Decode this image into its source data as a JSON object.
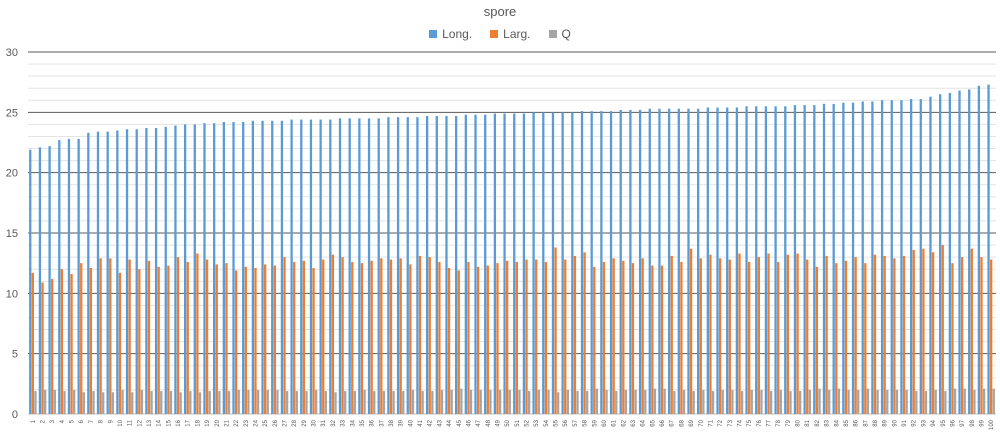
{
  "chart_data": {
    "type": "bar",
    "title": "spore",
    "xlabel": "",
    "ylabel": "",
    "ylim": [
      0,
      30
    ],
    "yticks": [
      0,
      5,
      10,
      15,
      20,
      25,
      30
    ],
    "grid": true,
    "legend_position": "top",
    "categories": [
      "1",
      "2",
      "3",
      "4",
      "5",
      "6",
      "7",
      "8",
      "9",
      "10",
      "11",
      "12",
      "13",
      "14",
      "15",
      "16",
      "17",
      "18",
      "19",
      "20",
      "21",
      "22",
      "23",
      "24",
      "25",
      "26",
      "27",
      "28",
      "29",
      "30",
      "31",
      "32",
      "33",
      "34",
      "35",
      "36",
      "37",
      "38",
      "39",
      "40",
      "41",
      "42",
      "43",
      "44",
      "45",
      "46",
      "47",
      "48",
      "49",
      "50",
      "51",
      "52",
      "53",
      "54",
      "55",
      "56",
      "57",
      "58",
      "59",
      "60",
      "61",
      "62",
      "63",
      "64",
      "65",
      "66",
      "67",
      "68",
      "69",
      "70",
      "71",
      "72",
      "73",
      "74",
      "75",
      "76",
      "77",
      "78",
      "79",
      "80",
      "81",
      "82",
      "83",
      "84",
      "85",
      "86",
      "87",
      "88",
      "89",
      "90",
      "91",
      "92",
      "93",
      "94",
      "95",
      "96",
      "97",
      "98",
      "99",
      "100"
    ],
    "series": [
      {
        "name": "Long.",
        "color": "#5B9BD5",
        "values": [
          21.9,
          22.1,
          22.2,
          22.7,
          22.8,
          22.8,
          23.3,
          23.4,
          23.4,
          23.5,
          23.6,
          23.6,
          23.7,
          23.7,
          23.8,
          23.9,
          24.0,
          24.0,
          24.1,
          24.1,
          24.2,
          24.2,
          24.2,
          24.3,
          24.3,
          24.3,
          24.3,
          24.4,
          24.4,
          24.4,
          24.4,
          24.4,
          24.5,
          24.5,
          24.5,
          24.5,
          24.5,
          24.6,
          24.6,
          24.6,
          24.6,
          24.7,
          24.7,
          24.7,
          24.7,
          24.8,
          24.8,
          24.8,
          24.9,
          24.9,
          24.9,
          24.9,
          25.0,
          25.0,
          25.0,
          25.0,
          25.0,
          25.1,
          25.1,
          25.1,
          25.1,
          25.2,
          25.2,
          25.2,
          25.3,
          25.3,
          25.3,
          25.3,
          25.3,
          25.3,
          25.4,
          25.4,
          25.4,
          25.4,
          25.5,
          25.5,
          25.5,
          25.5,
          25.5,
          25.6,
          25.6,
          25.6,
          25.7,
          25.7,
          25.8,
          25.8,
          25.9,
          25.9,
          26.0,
          26.0,
          26.0,
          26.1,
          26.1,
          26.3,
          26.5,
          26.6,
          26.8,
          26.9,
          27.2,
          27.3
        ]
      },
      {
        "name": "Larg.",
        "color": "#ED7D31",
        "values": [
          11.7,
          10.9,
          11.2,
          12.0,
          11.6,
          12.5,
          12.1,
          12.9,
          12.9,
          11.7,
          12.8,
          12.0,
          12.7,
          12.2,
          12.3,
          13.0,
          12.6,
          13.3,
          12.8,
          12.4,
          12.5,
          11.9,
          12.2,
          12.1,
          12.4,
          12.3,
          13.0,
          12.6,
          12.7,
          12.1,
          12.8,
          13.2,
          13.0,
          12.6,
          12.5,
          12.7,
          12.9,
          12.8,
          12.9,
          12.4,
          13.1,
          13.0,
          12.6,
          12.1,
          11.9,
          12.6,
          12.2,
          12.3,
          12.5,
          12.7,
          12.6,
          12.8,
          12.8,
          12.6,
          13.8,
          12.8,
          13.1,
          13.4,
          12.2,
          12.6,
          12.9,
          12.7,
          12.5,
          12.9,
          12.3,
          12.3,
          13.1,
          12.6,
          13.7,
          12.9,
          13.2,
          12.9,
          12.8,
          13.3,
          12.6,
          13.0,
          13.3,
          12.6,
          13.2,
          13.3,
          12.8,
          12.2,
          13.1,
          12.5,
          12.7,
          13.0,
          12.5,
          13.2,
          13.1,
          12.9,
          13.1,
          13.6,
          13.7,
          13.4,
          14.0,
          12.5,
          13.0,
          13.7,
          13.0,
          12.8
        ]
      },
      {
        "name": "Q",
        "color": "#A5A5A5",
        "values": [
          1.9,
          2.0,
          2.0,
          1.9,
          2.0,
          1.8,
          1.9,
          1.8,
          1.8,
          2.0,
          1.8,
          2.0,
          1.9,
          1.9,
          1.9,
          1.8,
          1.9,
          1.8,
          1.9,
          1.9,
          1.9,
          2.0,
          2.0,
          2.0,
          2.0,
          2.0,
          1.9,
          1.9,
          1.9,
          2.0,
          1.9,
          1.8,
          1.9,
          1.9,
          2.0,
          1.9,
          1.9,
          1.9,
          1.9,
          2.0,
          1.9,
          1.9,
          2.0,
          2.0,
          2.1,
          2.0,
          2.0,
          2.0,
          2.0,
          2.0,
          2.0,
          1.9,
          2.0,
          2.0,
          1.8,
          2.0,
          1.9,
          1.9,
          2.1,
          2.0,
          1.9,
          2.0,
          2.0,
          2.0,
          2.1,
          2.1,
          1.9,
          2.0,
          1.9,
          2.0,
          1.9,
          2.0,
          2.0,
          1.9,
          2.0,
          2.0,
          1.9,
          2.0,
          1.9,
          1.9,
          2.0,
          2.1,
          2.0,
          2.1,
          2.0,
          2.0,
          2.1,
          2.0,
          2.0,
          2.0,
          2.0,
          1.9,
          1.9,
          2.0,
          1.9,
          2.1,
          2.1,
          2.0,
          2.1,
          2.1
        ]
      }
    ]
  }
}
